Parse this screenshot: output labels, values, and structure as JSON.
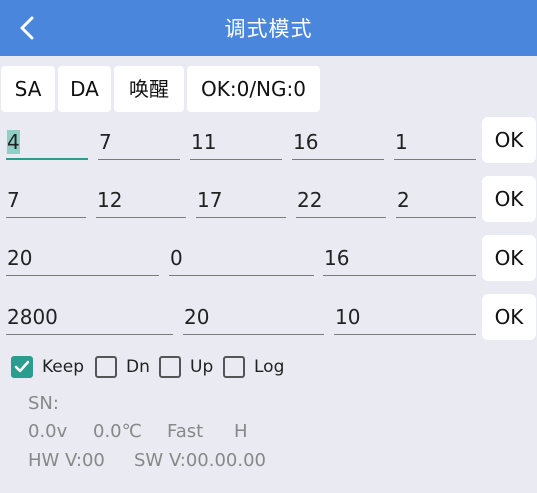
{
  "header": {
    "title": "调式模式"
  },
  "tags": [
    "SA",
    "DA",
    "唤醒",
    "OK:0/NG:0"
  ],
  "rows": [
    {
      "fields": [
        "4",
        "7",
        "11",
        "16",
        "1"
      ],
      "ok_label": "OK"
    },
    {
      "fields": [
        "7",
        "12",
        "17",
        "22",
        "2"
      ],
      "ok_label": "OK"
    },
    {
      "fields": [
        "20",
        "0",
        "16"
      ],
      "ok_label": "OK"
    },
    {
      "fields": [
        "2800",
        "20",
        "10"
      ],
      "ok_label": "OK"
    }
  ],
  "options": [
    {
      "label": "Keep",
      "checked": true
    },
    {
      "label": "Dn",
      "checked": false
    },
    {
      "label": "Up",
      "checked": false
    },
    {
      "label": "Log",
      "checked": false
    }
  ],
  "status": {
    "sn": "SN:",
    "voltage": "0.0v",
    "temperature": "0.0℃",
    "speed": "Fast",
    "level": "H",
    "hw_version": "HW V:00",
    "sw_version": "SW V:00.00.00"
  },
  "colors": {
    "header_bg": "#4a87dc",
    "accent": "#2a9d8f",
    "page_bg": "#eaeaf2"
  }
}
